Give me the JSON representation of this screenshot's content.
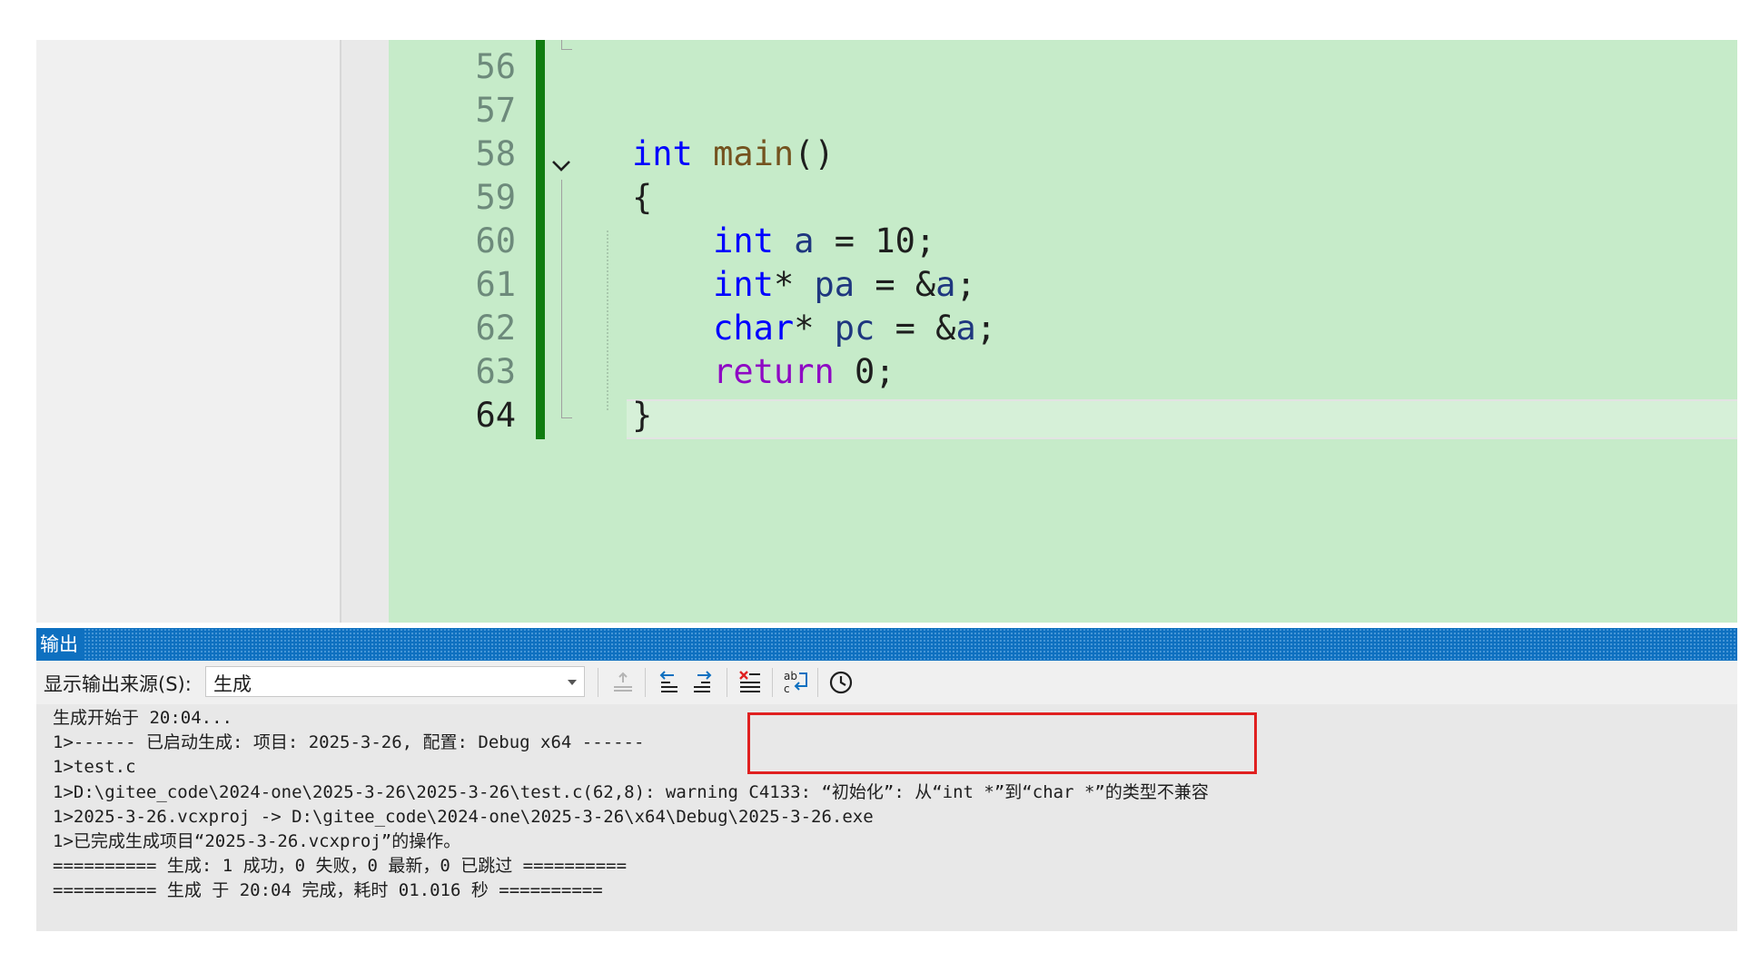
{
  "editor": {
    "line_numbers": [
      "56",
      "57",
      "58",
      "59",
      "60",
      "61",
      "62",
      "63",
      "64"
    ],
    "code_lines": [
      {
        "num": "58",
        "tokens": [
          {
            "t": "int",
            "c": "kw"
          },
          {
            "t": " ",
            "c": "op"
          },
          {
            "t": "main",
            "c": "fn"
          },
          {
            "t": "()",
            "c": "op"
          }
        ]
      },
      {
        "num": "59",
        "tokens": [
          {
            "t": "{",
            "c": "op"
          }
        ]
      },
      {
        "num": "60",
        "tokens": [
          {
            "t": "    ",
            "c": "op"
          },
          {
            "t": "int",
            "c": "kw"
          },
          {
            "t": " ",
            "c": "op"
          },
          {
            "t": "a",
            "c": "var"
          },
          {
            "t": " = 10;",
            "c": "op"
          }
        ]
      },
      {
        "num": "61",
        "tokens": [
          {
            "t": "    ",
            "c": "op"
          },
          {
            "t": "int",
            "c": "kw"
          },
          {
            "t": "* ",
            "c": "op"
          },
          {
            "t": "pa",
            "c": "var"
          },
          {
            "t": " = &",
            "c": "op"
          },
          {
            "t": "a",
            "c": "var"
          },
          {
            "t": ";",
            "c": "op"
          }
        ]
      },
      {
        "num": "62",
        "tokens": [
          {
            "t": "    ",
            "c": "op"
          },
          {
            "t": "char",
            "c": "kw"
          },
          {
            "t": "* ",
            "c": "op"
          },
          {
            "t": "pc",
            "c": "var"
          },
          {
            "t": " = &",
            "c": "op"
          },
          {
            "t": "a",
            "c": "var"
          },
          {
            "t": ";",
            "c": "op"
          }
        ]
      },
      {
        "num": "63",
        "tokens": [
          {
            "t": "    ",
            "c": "op"
          },
          {
            "t": "return",
            "c": "ret"
          },
          {
            "t": " 0;",
            "c": "op"
          }
        ]
      },
      {
        "num": "64",
        "tokens": [
          {
            "t": "}",
            "c": "op"
          }
        ]
      }
    ],
    "active_line": "64"
  },
  "output": {
    "title": "输出",
    "source_label": "显示输出来源(S):",
    "source_value": "生成",
    "toolbar_icons": [
      "go-to-source-icon",
      "previous-message-icon",
      "next-message-icon",
      "clear-all-icon",
      "toggle-word-wrap-icon",
      "show-timestamps-icon"
    ],
    "lines": [
      "生成开始于 20:04...",
      "1>------ 已启动生成: 项目: 2025-3-26, 配置: Debug x64 ------",
      "1>test.c",
      "1>D:\\gitee_code\\2024-one\\2025-3-26\\2025-3-26\\test.c(62,8): warning C4133: “初始化”: 从“int *”到“char *”的类型不兼容",
      "1>2025-3-26.vcxproj -> D:\\gitee_code\\2024-one\\2025-3-26\\x64\\Debug\\2025-3-26.exe",
      "1>已完成生成项目“2025-3-26.vcxproj”的操作。",
      "========== 生成: 1 成功，0 失败，0 最新，0 已跳过 ==========",
      "========== 生成 于 20:04 完成，耗时 01.016 秒 =========="
    ]
  },
  "colors": {
    "editor_bg": "#c6ebc9",
    "change_bar": "#107c10",
    "panel_title": "#0e70c0",
    "keyword": "#0000ff",
    "return_keyword": "#8f08c4",
    "highlight_box": "#e02020"
  }
}
